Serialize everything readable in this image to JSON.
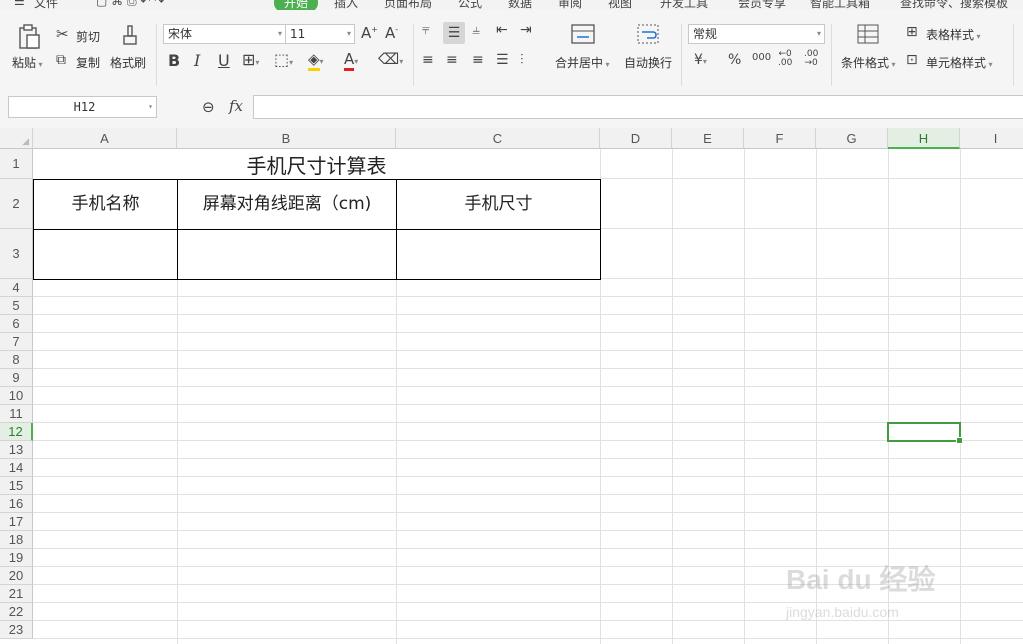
{
  "menu": {
    "file": "文件",
    "tabs": [
      "开始",
      "插入",
      "页面布局",
      "公式",
      "数据",
      "审阅",
      "视图",
      "开发工具",
      "会员专享",
      "智能工具箱"
    ],
    "search": "查找命令、搜索模板"
  },
  "ribbon": {
    "paste": "粘贴",
    "cut": "剪切",
    "copy": "复制",
    "format_painter": "格式刷",
    "font_name": "宋体",
    "font_size": "11",
    "merge_center": "合并居中",
    "wrap_text": "自动换行",
    "number_format": "常规",
    "cond_format": "条件格式",
    "table_style": "表格样式",
    "cell_style": "单元格样式"
  },
  "formula_bar": {
    "name_box": "H12",
    "fx": "fx",
    "content": ""
  },
  "columns": [
    "A",
    "B",
    "C",
    "D",
    "E",
    "F",
    "G",
    "H",
    "I"
  ],
  "rows": [
    "1",
    "2",
    "3",
    "4",
    "5",
    "6",
    "7",
    "8",
    "9",
    "10",
    "11",
    "12",
    "13",
    "14",
    "15",
    "16",
    "17",
    "18",
    "19",
    "20",
    "21",
    "22",
    "23"
  ],
  "selected": {
    "column": "H",
    "row": "12"
  },
  "sheet": {
    "title": "手机尺寸计算表",
    "headers": [
      "手机名称",
      "屏幕对角线距离（cm)",
      "手机尺寸"
    ]
  },
  "watermark": {
    "brand": "Bai du 经验",
    "url": "jingyan.baidu.com"
  }
}
